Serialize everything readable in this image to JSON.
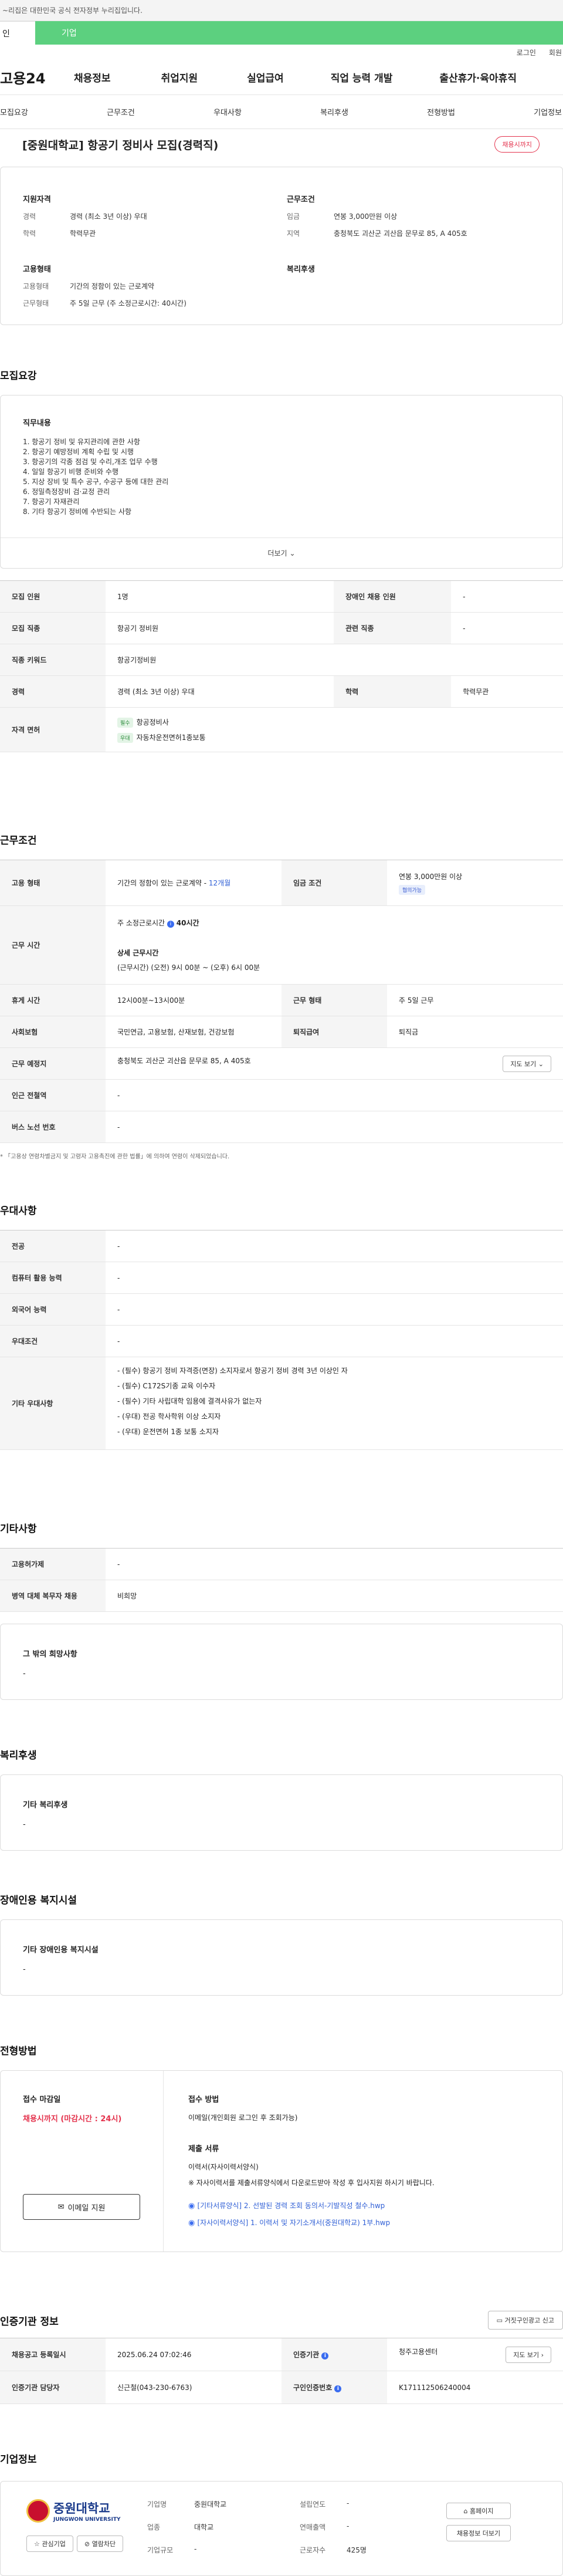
{
  "gov_notice": "~리집은 대한민국 공식 전자정부 누리집입니다.",
  "member_tabs": {
    "person": "인",
    "company": "기업"
  },
  "util_links": [
    "로그인",
    "회원"
  ],
  "site_logo": "고용24",
  "gnb": [
    "채용정보",
    "취업지원",
    "실업급여",
    "직업 능력 개발",
    "출산휴가·육아휴직"
  ],
  "subnav": [
    "모집요강",
    "근무조건",
    "우대사항",
    "복리후생",
    "전형방법",
    "기업정보"
  ],
  "job": {
    "title": "[중원대학교] 항공기 정비사 모집(경력직)",
    "status_badge": "채용시까지",
    "qual_title": "지원자격",
    "career_label": "경력",
    "career_value": "경력 (최소 3년 이상) 우대",
    "edu_label": "학력",
    "edu_value": "학력무관",
    "cond_title": "근무조건",
    "wage_label": "임금",
    "wage_value": "연봉 3,000만원 이상",
    "region_label": "지역",
    "region_value": "충청북도 괴산군 괴산읍 문무로 85, A 405호",
    "emp_title": "고용형태",
    "emp_type_label": "고용형태",
    "emp_type_value": "기간의 정함이 있는 근로계약",
    "work_form_label": "근무형태",
    "work_form_value": "주 5일 근무 (주 소정근로시간: 40시간)",
    "welfare_title": "복리후생"
  },
  "recruit": {
    "section_title": "모집요강",
    "duty_title": "직무내용",
    "duties": [
      "1. 항공기 정비 및 유지관리에 관한 사항",
      "2. 항공기 예방정비 계획 수립 및 시행",
      "3. 항공기의 각종 점검 및 수리,개조 업무 수행",
      "4. 일일 항공기 비행 준비와 수행",
      "5. 지상 장비 및 특수 공구, 수공구 등에 대한 관리",
      "6. 정밀측정장비 검·교정 관리",
      "7. 항공기 자재관리",
      "8. 기타 항공기 정비에 수반되는 사항"
    ],
    "more_label": "더보기",
    "rows": {
      "headcount_label": "모집 인원",
      "headcount": "1명",
      "disabled_label": "장애인 채용 인원",
      "disabled": "-",
      "job_label": "모집 직종",
      "job": "항공기 정비원",
      "related_label": "관련 직종",
      "related": "-",
      "keyword_label": "직종 키워드",
      "keyword": "항공기정비원",
      "career_label": "경력",
      "career": "경력 (최소 3년 이상) 우대",
      "edu_label": "학력",
      "edu": "학력무관",
      "license_label": "자격 면허",
      "license_tag1": "필수",
      "license1": "항공정비사",
      "license_tag2": "우대",
      "license2": "자동차운전면허1종보통"
    }
  },
  "conditions": {
    "section_title": "근무조건",
    "emp_label": "고용 형태",
    "emp_value": "기간의 정함이 있는 근로계약 - ",
    "emp_months": "12개월",
    "wage_label": "임금 조건",
    "wage_value": "연봉 3,000만원 이상",
    "wage_tag": "협의가능",
    "hours_label": "근무 시간",
    "hours_main": "주 소정근로시간",
    "hours_value": "40시간",
    "hours_detail_title": "상세 근무시간",
    "hours_detail": "(근무시간) (오전) 9시 00분 ~ (오후) 6시 00분",
    "break_label": "휴게 시간",
    "break_value": "12시00분~13시00분",
    "form_label": "근무 형태",
    "form_value": "주 5일 근무",
    "ins_label": "사회보험",
    "ins_value": "국민연금, 고용보험, 산재보험, 건강보험",
    "retire_label": "퇴직급여",
    "retire_value": "퇴직금",
    "place_label": "근무 예정지",
    "place_value": "충청북도 괴산군 괴산읍 문무로 85, A 405호",
    "map_btn": "지도 보기",
    "station_label": "인근 전철역",
    "station_value": "-",
    "bus_label": "버스 노선 번호",
    "bus_value": "-",
    "footnote": "* 「고용상 연령차별금지 및 고령자 고용촉진에 관한 법률」에 의하여 연령이 삭제되었습니다."
  },
  "prefer": {
    "section_title": "우대사항",
    "major_label": "전공",
    "major": "-",
    "pc_label": "컴퓨터 활용 능력",
    "pc": "-",
    "lang_label": "외국어 능력",
    "lang": "-",
    "cond_label": "우대조건",
    "cond": "-",
    "etc_label": "기타 우대사항",
    "etc_items": [
      "- (필수) 항공기 정비 자격증(면장) 소지자로서 항공기 정비 경력 3년 이상인 자",
      "- (필수) C172S기종 교육 이수자",
      "- (필수) 기타 사립대학 임용에 결격사유가 없는자",
      "- (우대) 전공 학사학위 이상 소지자",
      "- (우대) 운전면허 1종 보통 소지자"
    ]
  },
  "other": {
    "section_title": "기타사항",
    "emp_type_label": "고용허가제",
    "emp_type": "-",
    "military_label": "병역 대체 복무자 채용",
    "military": "비희망",
    "wish_title": "그 밖의 희망사항",
    "wish": "-"
  },
  "welfare": {
    "section_title": "복리후생",
    "box_title": "기타 복리후생",
    "box_value": "-"
  },
  "disability": {
    "section_title": "장애인용 복지시설",
    "box_title": "기타 장애인용 복지시설",
    "box_value": "-"
  },
  "selection": {
    "section_title": "전형방법",
    "deadline_title": "접수 마감일",
    "deadline": "채용시까지 (마감시간 : 24시)",
    "email_btn": "이메일 지원",
    "method_title": "접수 방법",
    "method": "이메일(개인회원 로그인 후 조회가능)",
    "docs_title": "제출 서류",
    "docs_line1": "이력서(자사이력서양식)",
    "docs_line2": "※ 자사이력서를 제출서류양식에서 다운로드받아 작성 후 입사지원 하시기 바랍니다.",
    "file1": "[기타서류양식] 2. 선발된 경력 조회 동의서-기발직성 철수.hwp",
    "file2": "[자사이력서양식] 1. 이력서 및 자기소개서(중원대학교) 1부.hwp"
  },
  "agency": {
    "section_title": "인증기관 정보",
    "report_btn": "거짓구인광고 신고",
    "reg_label": "채용공고 등록일시",
    "reg_value": "2025.06.24 07:02:46",
    "org_label": "인증기관",
    "org_value": "청주고용센터",
    "map_btn": "지도 보기",
    "mgr_label": "인증기관 담당자",
    "mgr_value": "신근철(043-230-6763)",
    "post_label": "구인인증번호",
    "post_value": "K171112506240004"
  },
  "company": {
    "section_title": "기업정보",
    "logo_ko": "중원대학교",
    "logo_en": "JUNGWON UNIVERSITY",
    "interest_btn": "관심기업",
    "follow_btn": "열람차단",
    "name_label": "기업명",
    "name": "중원대학교",
    "year_label": "설립연도",
    "year": "-",
    "industry_label": "업종",
    "industry": "대학교",
    "sales_label": "연매출액",
    "sales": "-",
    "scale_label": "기업규모",
    "scale": "-",
    "staff_label": "근로자수",
    "staff": "425명",
    "home_btn": "홈페이지",
    "jobs_btn": "채용정보 더보기"
  }
}
